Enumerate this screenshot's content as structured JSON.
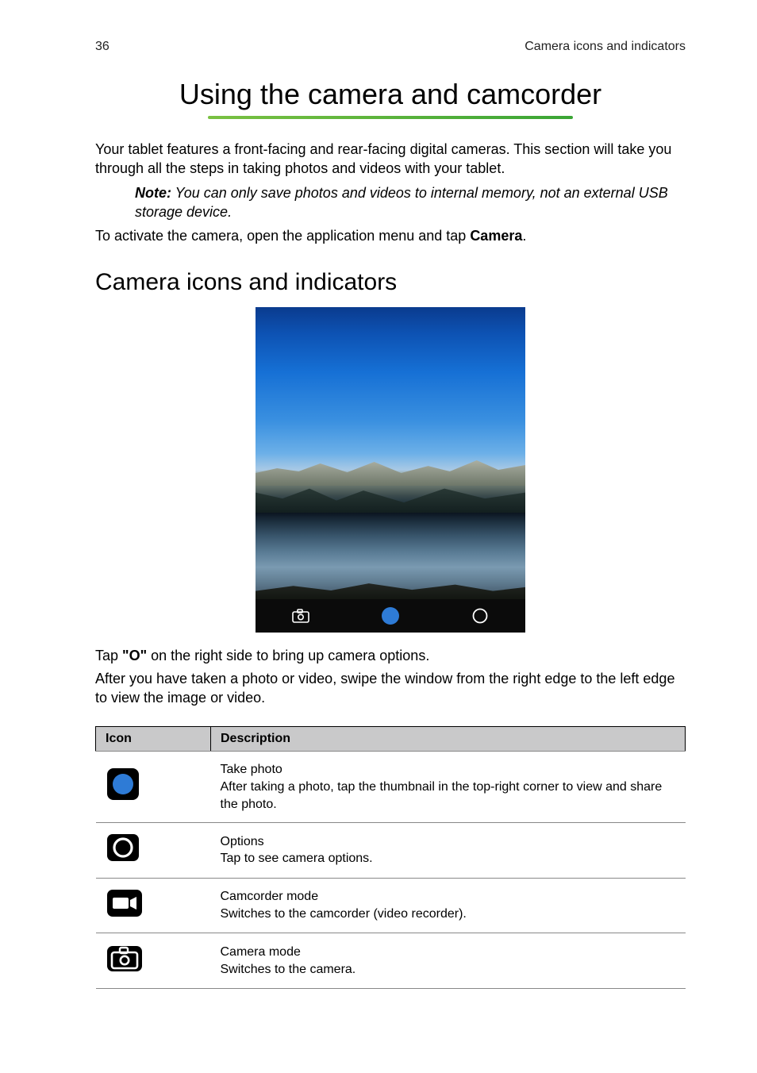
{
  "page_number": "36",
  "running_header": "Camera icons and indicators",
  "main_title": "Using the camera and camcorder",
  "intro_p1": "Your tablet features a front-facing and rear-facing digital cameras. This section will take you through all the steps in taking photos and videos with your tablet.",
  "note_label": "Note:",
  "note_text": " You can only save photos and videos to internal memory, not an external USB storage device.",
  "activate_prefix": "To activate the camera, open the application menu and tap ",
  "activate_bold": "Camera",
  "activate_suffix": ".",
  "section_heading": "Camera icons and indicators",
  "tap_prefix": "Tap ",
  "tap_bold": "\"O\"",
  "tap_suffix": " on the right side to bring up camera options.",
  "after_photo_text": "After you have taken a photo or video, swipe the window from the right edge to the left edge to view the image or video.",
  "table": {
    "headers": {
      "icon": "Icon",
      "description": "Description"
    },
    "rows": [
      {
        "icon_id": "take-photo-icon",
        "title": "Take photo",
        "detail": "After taking a photo, tap the thumbnail in the top-right corner to view and share the photo."
      },
      {
        "icon_id": "options-icon",
        "title": "Options",
        "detail": "Tap to see camera options."
      },
      {
        "icon_id": "camcorder-mode-icon",
        "title": "Camcorder mode",
        "detail": "Switches to the camcorder (video recorder)."
      },
      {
        "icon_id": "camera-mode-icon",
        "title": "Camera mode",
        "detail": "Switches to the camera."
      }
    ]
  }
}
